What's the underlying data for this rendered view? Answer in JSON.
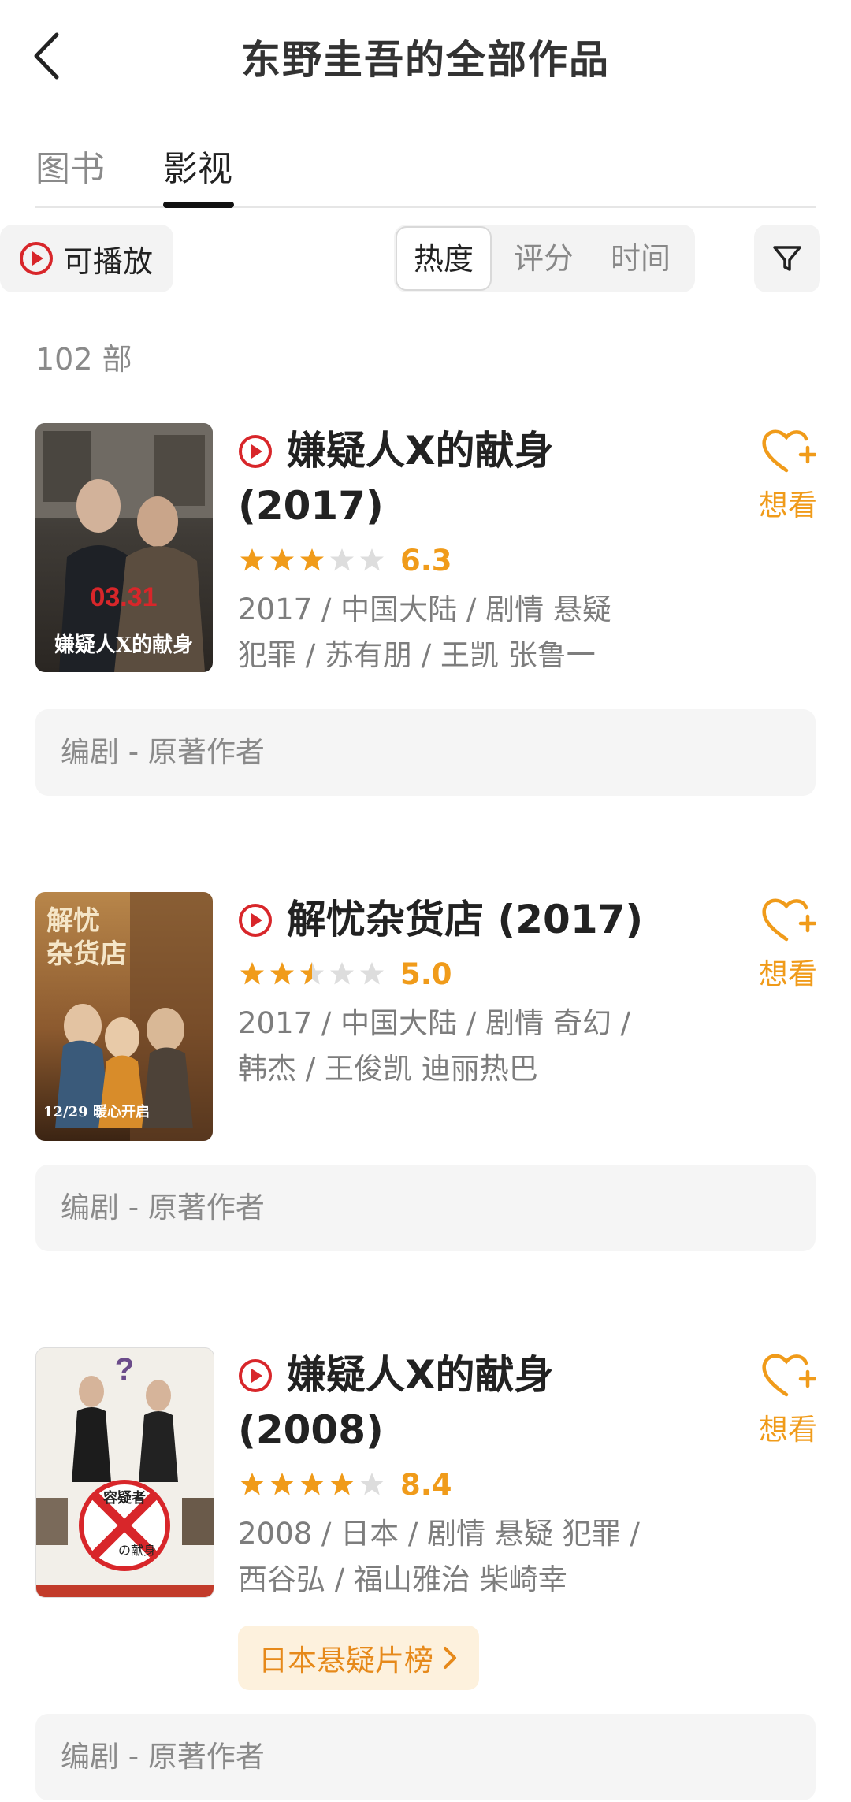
{
  "header": {
    "title": "东野圭吾的全部作品"
  },
  "tabs": [
    {
      "label": "图书"
    },
    {
      "label": "影视"
    }
  ],
  "filters": {
    "playable_label": "可播放",
    "sort_options": [
      {
        "label": "热度"
      },
      {
        "label": "评分"
      },
      {
        "label": "时间"
      }
    ]
  },
  "count_text": "102 部",
  "items": [
    {
      "title_line1": "嫌疑人X的献身",
      "title_line2": "(2017)",
      "rating": "6.3",
      "stars": 3,
      "meta_line1": "2017 / 中国大陆 / 剧情 悬疑",
      "meta_line2": "犯罪 / 苏有朋 / 王凯 张鲁一",
      "want_label": "想看",
      "role": "编剧 - 原著作者",
      "poster": {
        "date": "03.31",
        "text": "嫌疑人X的献身"
      }
    },
    {
      "title_line1": "解忧杂货店 (2017)",
      "rating": "5.0",
      "stars": 2.5,
      "meta_line1": "2017 / 中国大陆 / 剧情 奇幻 /",
      "meta_line2": "韩杰 / 王俊凯 迪丽热巴",
      "want_label": "想看",
      "role": "编剧 - 原著作者",
      "poster": {
        "top_text": "解忧\n杂货店",
        "bottom_text": "12/29 暖心开启"
      }
    },
    {
      "title_line1": "嫌疑人X的献身",
      "title_line2": "(2008)",
      "rating": "8.4",
      "stars": 4,
      "meta_line1": "2008 / 日本 / 剧情 悬疑 犯罪 /",
      "meta_line2": "西谷弘 / 福山雅治 柴崎幸",
      "want_label": "想看",
      "rank_label": "日本悬疑片榜",
      "role": "编剧 - 原著作者",
      "poster": {
        "center_text": "容疑者",
        "sub_text": "の献身"
      }
    }
  ],
  "colors": {
    "accent": "#f09b1a",
    "play_red": "#d8262a",
    "chip_bg": "#fdf1dd"
  }
}
